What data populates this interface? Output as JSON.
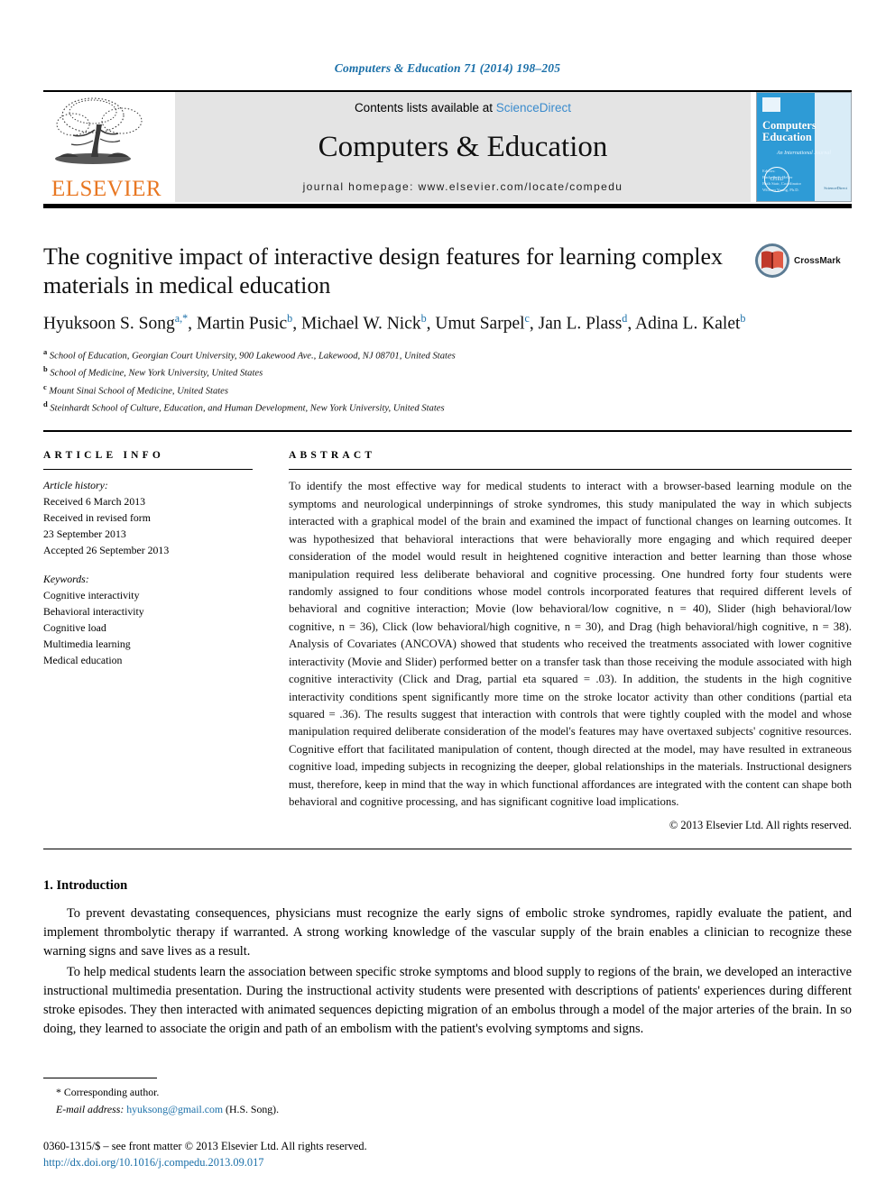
{
  "running_head": "Computers & Education 71 (2014) 198–205",
  "banner": {
    "publisher_wordmark": "ELSEVIER",
    "contents_prefix": "Contents lists available at ",
    "contents_link": "ScienceDirect",
    "journal_title": "Computers & Education",
    "homepage": "journal homepage: www.elsevier.com/locate/compedu",
    "cover": {
      "title_line1": "Computers",
      "title_line2": "Education",
      "ampersand": "&",
      "subtitle": "An International Journal",
      "editors": "Editors:\nRachelle S. Heller\nRuth Stair, Coordinator\nWilliam Young, Ph.D.",
      "seal": "CITED",
      "sciencedirect": "ScienceDirect"
    }
  },
  "article": {
    "title": "The cognitive impact of interactive design features for learning complex materials in medical education",
    "crossmark_label": "CrossMark",
    "authors_html": "Hyuksoon S. Song<sup>a,*</sup>, Martin Pusic<sup>b</sup>, Michael W. Nick<sup>b</sup>, Umut Sarpel<sup>c</sup>, Jan L. Plass<sup>d</sup>, Adina L. Kalet<sup>b</sup>",
    "affiliations": [
      {
        "marker": "a",
        "text": "School of Education, Georgian Court University, 900 Lakewood Ave., Lakewood, NJ 08701, United States"
      },
      {
        "marker": "b",
        "text": "School of Medicine, New York University, United States"
      },
      {
        "marker": "c",
        "text": "Mount Sinai School of Medicine, United States"
      },
      {
        "marker": "d",
        "text": "Steinhardt School of Culture, Education, and Human Development, New York University, United States"
      }
    ]
  },
  "article_info": {
    "heading": "ARTICLE INFO",
    "history_label": "Article history:",
    "history": [
      "Received 6 March 2013",
      "Received in revised form",
      "23 September 2013",
      "Accepted 26 September 2013"
    ],
    "keywords_label": "Keywords:",
    "keywords": [
      "Cognitive interactivity",
      "Behavioral interactivity",
      "Cognitive load",
      "Multimedia learning",
      "Medical education"
    ]
  },
  "abstract": {
    "heading": "ABSTRACT",
    "text": "To identify the most effective way for medical students to interact with a browser-based learning module on the symptoms and neurological underpinnings of stroke syndromes, this study manipulated the way in which subjects interacted with a graphical model of the brain and examined the impact of functional changes on learning outcomes. It was hypothesized that behavioral interactions that were behaviorally more engaging and which required deeper consideration of the model would result in heightened cognitive interaction and better learning than those whose manipulation required less deliberate behavioral and cognitive processing. One hundred forty four students were randomly assigned to four conditions whose model controls incorporated features that required different levels of behavioral and cognitive interaction; Movie (low behavioral/low cognitive, n = 40), Slider (high behavioral/low cognitive, n = 36), Click (low behavioral/high cognitive, n = 30), and Drag (high behavioral/high cognitive, n = 38). Analysis of Covariates (ANCOVA) showed that students who received the treatments associated with lower cognitive interactivity (Movie and Slider) performed better on a transfer task than those receiving the module associated with high cognitive interactivity (Click and Drag, partial eta squared = .03). In addition, the students in the high cognitive interactivity conditions spent significantly more time on the stroke locator activity than other conditions (partial eta squared = .36). The results suggest that interaction with controls that were tightly coupled with the model and whose manipulation required deliberate consideration of the model's features may have overtaxed subjects' cognitive resources. Cognitive effort that facilitated manipulation of content, though directed at the model, may have resulted in extraneous cognitive load, impeding subjects in recognizing the deeper, global relationships in the materials. Instructional designers must, therefore, keep in mind that the way in which functional affordances are integrated with the content can shape both behavioral and cognitive processing, and has significant cognitive load implications.",
    "copyright": "© 2013 Elsevier Ltd. All rights reserved."
  },
  "body": {
    "section_number_title": "1. Introduction",
    "paragraphs": [
      "To prevent devastating consequences, physicians must recognize the early signs of embolic stroke syndromes, rapidly evaluate the patient, and implement thrombolytic therapy if warranted. A strong working knowledge of the vascular supply of the brain enables a clinician to recognize these warning signs and save lives as a result.",
      "To help medical students learn the association between specific stroke symptoms and blood supply to regions of the brain, we developed an interactive instructional multimedia presentation. During the instructional activity students were presented with descriptions of patients' experiences during different stroke episodes. They then interacted with animated sequences depicting migration of an embolus through a model of the major arteries of the brain. In so doing, they learned to associate the origin and path of an embolism with the patient's evolving symptoms and signs."
    ]
  },
  "footer": {
    "corresponding_author": "* Corresponding author.",
    "email_label": "E-mail address:",
    "email": "hyuksong@gmail.com",
    "email_suffix": "(H.S. Song).",
    "issn_line": "0360-1315/$ – see front matter © 2013 Elsevier Ltd. All rights reserved.",
    "doi": "http://dx.doi.org/10.1016/j.compedu.2013.09.017"
  },
  "colors": {
    "link_blue": "#1a6fa8",
    "sciencedirect_blue": "#3a8bcd",
    "elsevier_orange": "#E87722",
    "cover_blue": "#2e9bd6",
    "banner_grey": "#e4e4e4"
  }
}
